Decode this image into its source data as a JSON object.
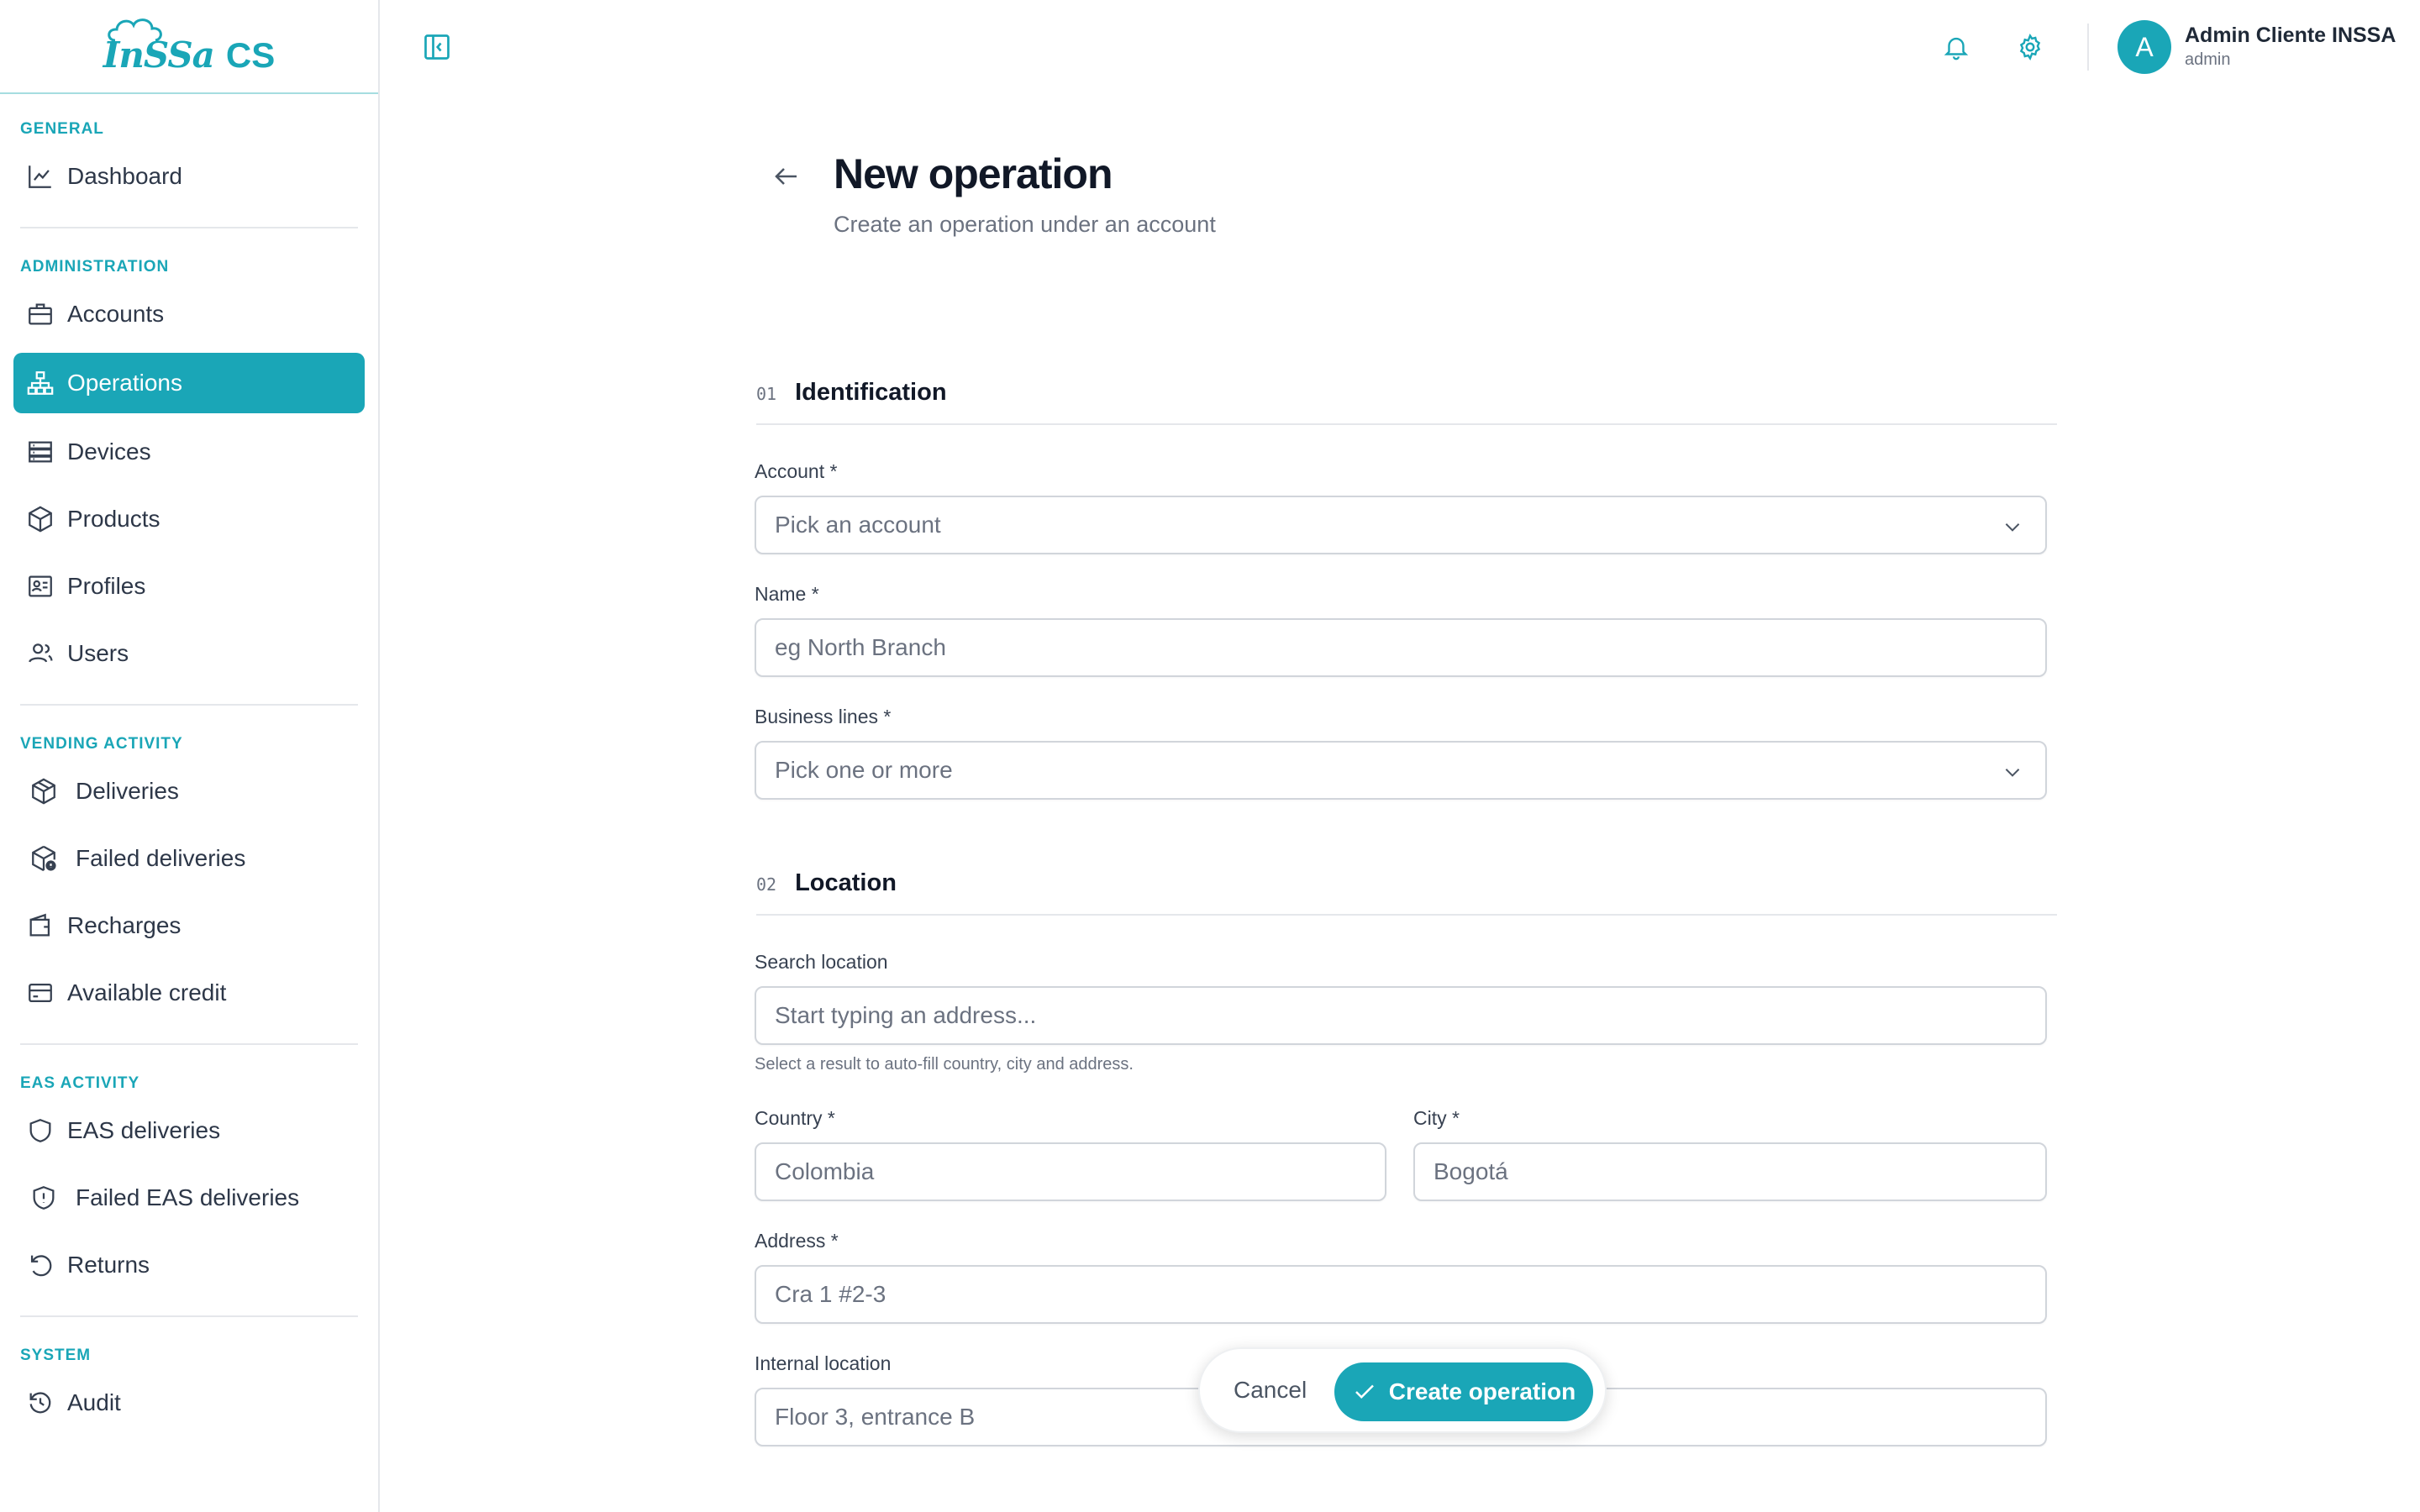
{
  "app": {
    "logo_text": "InSSa",
    "logo_suffix": "CS"
  },
  "sidebar": {
    "sections": [
      {
        "label": "GENERAL",
        "items": [
          {
            "label": "Dashboard",
            "icon": "chart-line-icon"
          }
        ]
      },
      {
        "label": "ADMINISTRATION",
        "items": [
          {
            "label": "Accounts",
            "icon": "briefcase-icon"
          },
          {
            "label": "Operations",
            "icon": "network-icon",
            "active": true
          },
          {
            "label": "Devices",
            "icon": "server-icon"
          },
          {
            "label": "Products",
            "icon": "box-icon"
          },
          {
            "label": "Profiles",
            "icon": "id-card-icon"
          },
          {
            "label": "Users",
            "icon": "users-icon"
          }
        ]
      },
      {
        "label": "VENDING ACTIVITY",
        "items": [
          {
            "label": "Deliveries",
            "icon": "package-icon"
          },
          {
            "label": "Failed deliveries",
            "icon": "package-alert-icon"
          },
          {
            "label": "Recharges",
            "icon": "wallet-icon"
          },
          {
            "label": "Available credit",
            "icon": "credit-card-icon"
          }
        ]
      },
      {
        "label": "EAS ACTIVITY",
        "items": [
          {
            "label": "EAS deliveries",
            "icon": "shield-icon"
          },
          {
            "label": "Failed EAS deliveries",
            "icon": "shield-alert-icon"
          },
          {
            "label": "Returns",
            "icon": "undo-icon"
          }
        ]
      },
      {
        "label": "SYSTEM",
        "items": [
          {
            "label": "Audit",
            "icon": "history-icon"
          }
        ]
      }
    ]
  },
  "header": {
    "user_initial": "A",
    "user_name": "Admin Cliente INSSA",
    "user_role": "admin"
  },
  "page": {
    "title": "New operation",
    "subtitle": "Create an operation under an account"
  },
  "form": {
    "identification": {
      "number": "01",
      "title": "Identification",
      "account_label": "Account *",
      "account_placeholder": "Pick an account",
      "name_label": "Name *",
      "name_placeholder": "eg North Branch",
      "business_lines_label": "Business lines *",
      "business_lines_placeholder": "Pick one or more"
    },
    "location": {
      "number": "02",
      "title": "Location",
      "search_label": "Search location",
      "search_placeholder": "Start typing an address...",
      "search_hint": "Select a result to auto-fill country, city and address.",
      "country_label": "Country *",
      "country_value": "Colombia",
      "city_label": "City *",
      "city_value": "Bogotá",
      "address_label": "Address *",
      "address_value": "Cra 1 #2-3",
      "internal_label": "Internal location",
      "internal_value": "Floor 3, entrance B"
    }
  },
  "actions": {
    "cancel_label": "Cancel",
    "create_label": "Create operation"
  },
  "colors": {
    "accent": "#1aa6b7"
  }
}
